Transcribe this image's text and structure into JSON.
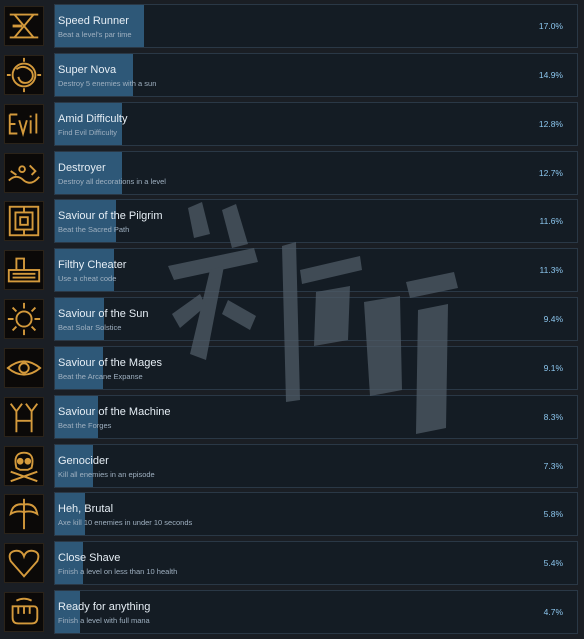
{
  "achievements": [
    {
      "title": "Speed Runner",
      "desc": "Beat a level's par time",
      "pct": "17.0%",
      "progress": 0.17,
      "icon": "hourglass-icon"
    },
    {
      "title": "Super Nova",
      "desc": "Destroy 5 enemies with a sun",
      "pct": "14.9%",
      "progress": 0.149,
      "icon": "sun-swirl-icon"
    },
    {
      "title": "Amid Difficulty",
      "desc": "Find Evil Difficulty",
      "pct": "12.8%",
      "progress": 0.128,
      "icon": "evil-text-icon"
    },
    {
      "title": "Destroyer",
      "desc": "Destroy all decorations in a level",
      "pct": "12.7%",
      "progress": 0.127,
      "icon": "rubble-icon"
    },
    {
      "title": "Saviour of the Pilgrim",
      "desc": "Beat the Sacred Path",
      "pct": "11.6%",
      "progress": 0.116,
      "icon": "maze-icon"
    },
    {
      "title": "Filthy Cheater",
      "desc": "Use a cheat code",
      "pct": "11.3%",
      "progress": 0.113,
      "icon": "keyboard-icon"
    },
    {
      "title": "Saviour of the Sun",
      "desc": "Beat Solar Solstice",
      "pct": "9.4%",
      "progress": 0.094,
      "icon": "sun-icon"
    },
    {
      "title": "Saviour of the Mages",
      "desc": "Beat the Arcane Expanse",
      "pct": "9.1%",
      "progress": 0.091,
      "icon": "eye-icon"
    },
    {
      "title": "Saviour of the Machine",
      "desc": "Beat the Forges",
      "pct": "8.3%",
      "progress": 0.083,
      "icon": "machine-icon"
    },
    {
      "title": "Genocider",
      "desc": "Kill all enemies in an episode",
      "pct": "7.3%",
      "progress": 0.073,
      "icon": "skull-icon"
    },
    {
      "title": "Heh, Brutal",
      "desc": "Axe kill 10 enemies in under 10 seconds",
      "pct": "5.8%",
      "progress": 0.058,
      "icon": "axe-icon"
    },
    {
      "title": "Close Shave",
      "desc": "Finish a level on less than 10 health",
      "pct": "5.4%",
      "progress": 0.054,
      "icon": "heart-icon"
    },
    {
      "title": "Ready for anything",
      "desc": "Finish a level with full mana",
      "pct": "4.7%",
      "progress": 0.047,
      "icon": "fist-icon"
    }
  ],
  "colors": {
    "background": "#1a1e24",
    "bar_fill": "#2e5878",
    "percent_text": "#8cc6ee",
    "icon_gold": "#d49a3c"
  }
}
